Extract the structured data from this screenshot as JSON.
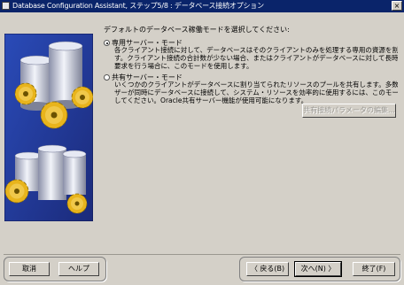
{
  "window": {
    "title": "Database Configuration Assistant, ステップ5/8 : データベース接続オプション",
    "close_glyph": "×"
  },
  "prompt": "デフォルトのデータベース稼働モードを選択してください:",
  "options": [
    {
      "label": "専用サーバー・モード",
      "selected": true,
      "description": [
        "各クライアント接続に対して、データベースはそのクライアントのみを処理する専用の資源を割り当てま",
        "す。クライアント接続の合計数が少ない場合、またはクライアントがデータベースに対して長時間に及ぶ",
        "要求を行う場合に、このモードを使用します。"
      ]
    },
    {
      "label": "共有サーバー・モード",
      "selected": false,
      "description": [
        "いくつかのクライアントがデータベースに割り当てられたリソースのプールを共有します。多数のユー",
        "ザーが同時にデータベースに接続して、システム・リソースを効率的に使用するには、このモードを使用",
        "してください。Oracle共有サーバー機能が使用可能になります。"
      ]
    }
  ],
  "shared_params_button": "共有接続パラメータの編集...",
  "footer": {
    "cancel": "取消",
    "help": "ヘルプ",
    "back": "〈 戻る(B)",
    "next": "次へ(N) 〉",
    "finish": "終了(F)"
  }
}
